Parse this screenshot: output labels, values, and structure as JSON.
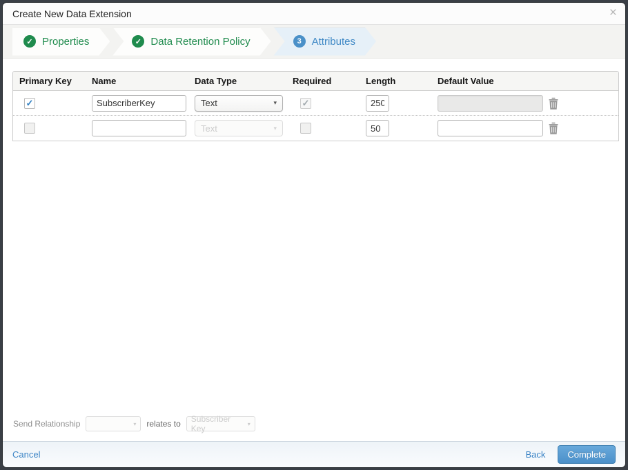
{
  "modal": {
    "title": "Create New Data Extension",
    "close_glyph": "×"
  },
  "wizard": {
    "steps": [
      {
        "label": "Properties",
        "status": "complete",
        "glyph": "✓"
      },
      {
        "label": "Data Retention Policy",
        "status": "complete",
        "glyph": "✓"
      },
      {
        "label": "Attributes",
        "status": "active",
        "glyph": "3"
      }
    ]
  },
  "attributes_table": {
    "columns": {
      "primary_key": "Primary Key",
      "name": "Name",
      "data_type": "Data Type",
      "required": "Required",
      "length": "Length",
      "default_value": "Default Value"
    },
    "rows": [
      {
        "primary_key_checked": true,
        "name": "SubscriberKey",
        "data_type": "Text",
        "data_type_disabled": false,
        "required_checked": true,
        "required_disabled": true,
        "length": "250",
        "default_value": "",
        "default_disabled": true
      },
      {
        "primary_key_checked": false,
        "name": "",
        "data_type": "Text",
        "data_type_disabled": true,
        "required_checked": false,
        "required_disabled": false,
        "length": "50",
        "default_value": "",
        "default_disabled": false
      }
    ]
  },
  "icons": {
    "check": "✓",
    "select_arrow": "▾"
  },
  "send_relationship": {
    "label": "Send Relationship",
    "field_value": "",
    "relates_to": "relates to",
    "target_value": "Subscriber Key"
  },
  "footer": {
    "cancel": "Cancel",
    "back": "Back",
    "complete": "Complete"
  },
  "colors": {
    "step_complete_green": "#1f8b4d",
    "step_active_blue": "#4a90c8",
    "link_blue": "#3d85c6",
    "complete_button": "#4b90c9"
  }
}
